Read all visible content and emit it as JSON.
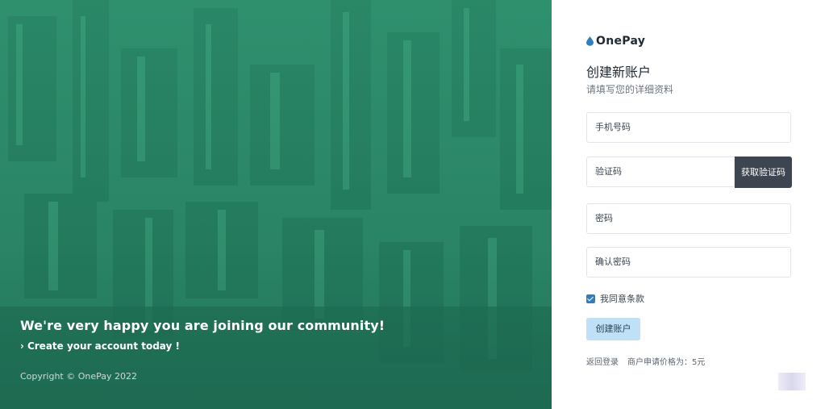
{
  "hero": {
    "headline": "We're very happy you are joining our community!",
    "sub_chevron": "›",
    "sub": "Create your account today !",
    "copyright": "Copyright © OnePay 2022",
    "tint_color": "#2f8a6c"
  },
  "brand": {
    "name": "OnePay",
    "icon": "water-drop-icon",
    "color": "#2f7fc0"
  },
  "form": {
    "title": "创建新账户",
    "subtitle": "请填写您的详细资料",
    "phone_label": "手机号码",
    "code_label": "验证码",
    "get_code_label": "获取验证码",
    "password_label": "密码",
    "confirm_password_label": "确认密码",
    "agree_label": "我同意条款",
    "agree_checked": true,
    "submit_label": "创建账户",
    "back_to_login": "返回登录",
    "merchant_price": "商户申请价格为：5元"
  },
  "colors": {
    "code_button": "#3d4650",
    "submit_button": "#bfe0f6",
    "checkbox": "#2f7fc0"
  }
}
